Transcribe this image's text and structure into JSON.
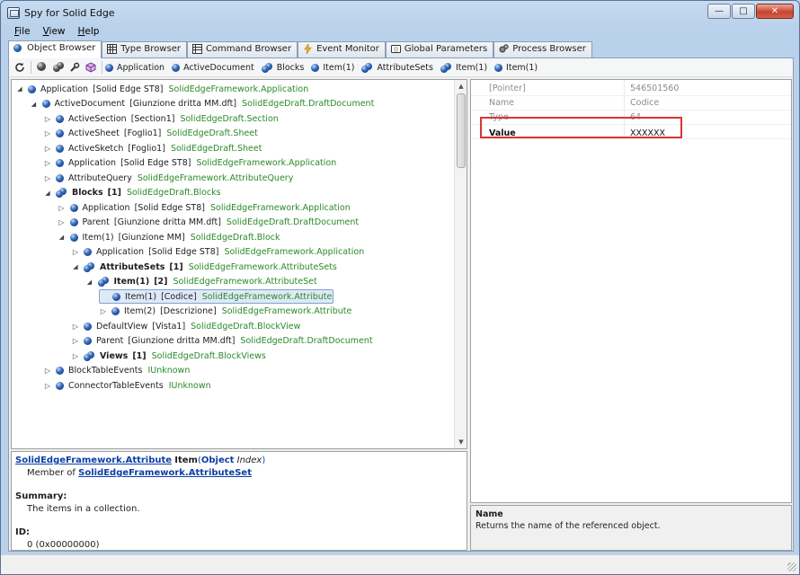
{
  "window": {
    "title": "Spy for Solid Edge"
  },
  "menu": [
    {
      "label": "File",
      "key": "F",
      "rest": "ile"
    },
    {
      "label": "View",
      "key": "V",
      "rest": "iew"
    },
    {
      "label": "Help",
      "key": "H",
      "rest": "elp"
    }
  ],
  "tabs": [
    {
      "label": "Object Browser",
      "icon": "object-ball-icon",
      "active": true
    },
    {
      "label": "Type Browser",
      "icon": "type-grid-icon",
      "active": false
    },
    {
      "label": "Command Browser",
      "icon": "command-grid-icon",
      "active": false
    },
    {
      "label": "Event Monitor",
      "icon": "lightning-icon",
      "active": false
    },
    {
      "label": "Global Parameters",
      "icon": "global-params-icon",
      "active": false
    },
    {
      "label": "Process Browser",
      "icon": "gears-icon",
      "active": false
    }
  ],
  "breadcrumb": [
    {
      "label": "Application",
      "icon": "object"
    },
    {
      "label": "ActiveDocument",
      "icon": "object"
    },
    {
      "label": "Blocks",
      "icon": "collection"
    },
    {
      "label": "Item(1)",
      "icon": "object"
    },
    {
      "label": "AttributeSets",
      "icon": "collection"
    },
    {
      "label": "Item(1)",
      "icon": "collection"
    },
    {
      "label": "Item(1)",
      "icon": "object"
    }
  ],
  "tree": [
    {
      "level": 0,
      "toggle": "open",
      "icon": "object",
      "name": "Application",
      "detail": "[Solid Edge ST8]",
      "type": "SolidEdgeFramework.Application",
      "bold": false
    },
    {
      "level": 1,
      "toggle": "open",
      "icon": "object",
      "name": "ActiveDocument",
      "detail": "[Giunzione dritta MM.dft]",
      "type": "SolidEdgeDraft.DraftDocument",
      "bold": false
    },
    {
      "level": 2,
      "toggle": "closed",
      "icon": "object",
      "name": "ActiveSection",
      "detail": "[Section1]",
      "type": "SolidEdgeDraft.Section",
      "bold": false
    },
    {
      "level": 2,
      "toggle": "closed",
      "icon": "object",
      "name": "ActiveSheet",
      "detail": "[Foglio1]",
      "type": "SolidEdgeDraft.Sheet",
      "bold": false
    },
    {
      "level": 2,
      "toggle": "closed",
      "icon": "object",
      "name": "ActiveSketch",
      "detail": "[Foglio1]",
      "type": "SolidEdgeDraft.Sheet",
      "bold": false
    },
    {
      "level": 2,
      "toggle": "closed",
      "icon": "object",
      "name": "Application",
      "detail": "[Solid Edge ST8]",
      "type": "SolidEdgeFramework.Application",
      "bold": false
    },
    {
      "level": 2,
      "toggle": "closed",
      "icon": "object",
      "name": "AttributeQuery",
      "detail": "",
      "type": "SolidEdgeFramework.AttributeQuery",
      "bold": false
    },
    {
      "level": 2,
      "toggle": "open",
      "icon": "collection",
      "name": "Blocks",
      "detail": "[1]",
      "type": "SolidEdgeDraft.Blocks",
      "bold": true
    },
    {
      "level": 3,
      "toggle": "closed",
      "icon": "object",
      "name": "Application",
      "detail": "[Solid Edge ST8]",
      "type": "SolidEdgeFramework.Application",
      "bold": false
    },
    {
      "level": 3,
      "toggle": "closed",
      "icon": "object",
      "name": "Parent",
      "detail": "[Giunzione dritta MM.dft]",
      "type": "SolidEdgeDraft.DraftDocument",
      "bold": false
    },
    {
      "level": 3,
      "toggle": "open",
      "icon": "object",
      "name": "Item(1)",
      "detail": "[Giunzione MM]",
      "type": "SolidEdgeDraft.Block",
      "bold": false
    },
    {
      "level": 4,
      "toggle": "closed",
      "icon": "object",
      "name": "Application",
      "detail": "[Solid Edge ST8]",
      "type": "SolidEdgeFramework.Application",
      "bold": false
    },
    {
      "level": 4,
      "toggle": "open",
      "icon": "collection",
      "name": "AttributeSets",
      "detail": "[1]",
      "type": "SolidEdgeFramework.AttributeSets",
      "bold": true
    },
    {
      "level": 5,
      "toggle": "open",
      "icon": "collection",
      "name": "Item(1)",
      "detail": "[2]",
      "type": "SolidEdgeFramework.AttributeSet",
      "bold": true
    },
    {
      "level": 6,
      "toggle": "none",
      "icon": "object",
      "name": "Item(1)",
      "detail": "[Codice]",
      "type": "SolidEdgeFramework.Attribute",
      "bold": false,
      "selected": true
    },
    {
      "level": 6,
      "toggle": "closed",
      "icon": "object",
      "name": "Item(2)",
      "detail": "[Descrizione]",
      "type": "SolidEdgeFramework.Attribute",
      "bold": false
    },
    {
      "level": 4,
      "toggle": "closed",
      "icon": "object",
      "name": "DefaultView",
      "detail": "[Vista1]",
      "type": "SolidEdgeDraft.BlockView",
      "bold": false
    },
    {
      "level": 4,
      "toggle": "closed",
      "icon": "object",
      "name": "Parent",
      "detail": "[Giunzione dritta MM.dft]",
      "type": "SolidEdgeDraft.DraftDocument",
      "bold": false
    },
    {
      "level": 4,
      "toggle": "closed",
      "icon": "collection",
      "name": "Views",
      "detail": "[1]",
      "type": "SolidEdgeDraft.BlockViews",
      "bold": true
    },
    {
      "level": 2,
      "toggle": "closed",
      "icon": "object",
      "name": "BlockTableEvents",
      "detail": "",
      "type": "IUnknown",
      "bold": false
    },
    {
      "level": 2,
      "toggle": "closed",
      "icon": "object",
      "name": "ConnectorTableEvents",
      "detail": "",
      "type": "IUnknown",
      "bold": false
    }
  ],
  "doc": {
    "type_link": "SolidEdgeFramework.Attribute",
    "member": "Item",
    "paren_open": "(",
    "param_type": "Object",
    "param_name": "Index",
    "paren_close": ")",
    "member_of_label": "Member of",
    "member_of_link": "SolidEdgeFramework.AttributeSet",
    "summary_label": "Summary:",
    "summary_text": "The items in a collection.",
    "id_label": "ID:",
    "id_value": "0 (0x00000000)"
  },
  "properties": [
    {
      "name": "[Pointer]",
      "value": "546501560",
      "style": "dim"
    },
    {
      "name": "Name",
      "value": "Codice",
      "style": "dim"
    },
    {
      "name": "Type",
      "value": "64",
      "style": "dim"
    },
    {
      "name": "Value",
      "value": "XXXXXX",
      "style": "highlight"
    }
  ],
  "description": {
    "title": "Name",
    "text": "Returns the name of the referenced object."
  },
  "colors": {
    "type_green": "#2a8a2a",
    "link_blue": "#0b3fa6",
    "highlight_red": "#d93434"
  }
}
